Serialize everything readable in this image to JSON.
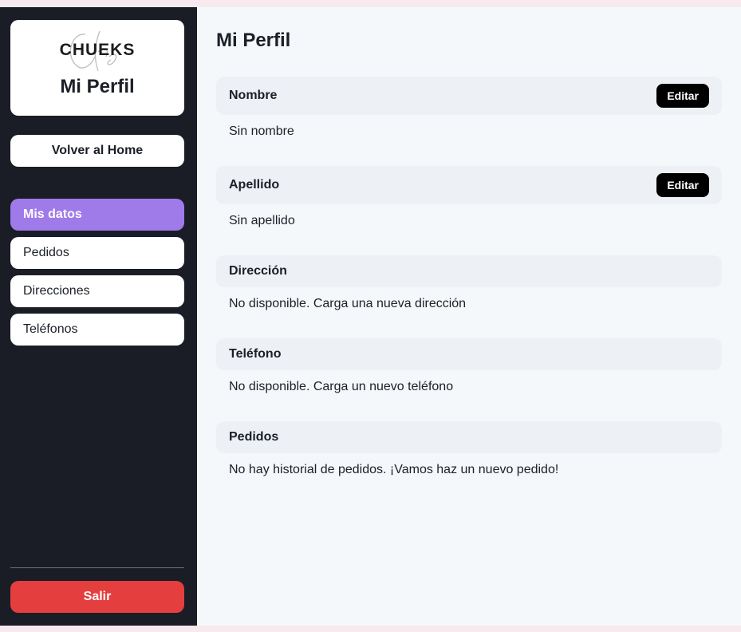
{
  "sidebar": {
    "logo_text": "CHUEKS",
    "brand_title": "Mi Perfil",
    "home_button": "Volver al Home",
    "nav": [
      {
        "label": "Mis datos",
        "active": true
      },
      {
        "label": "Pedidos",
        "active": false
      },
      {
        "label": "Direcciones",
        "active": false
      },
      {
        "label": "Teléfonos",
        "active": false
      }
    ],
    "logout_button": "Salir"
  },
  "main": {
    "title": "Mi Perfil",
    "sections": [
      {
        "label": "Nombre",
        "value": "Sin nombre",
        "edit_label": "Editar"
      },
      {
        "label": "Apellido",
        "value": "Sin apellido",
        "edit_label": "Editar"
      },
      {
        "label": "Dirección",
        "value": "No disponible. Carga una nueva dirección"
      },
      {
        "label": "Teléfono",
        "value": "No disponible. Carga un nuevo teléfono"
      },
      {
        "label": "Pedidos",
        "value": "No hay historial de pedidos. ¡Vamos haz un nuevo pedido!"
      }
    ]
  },
  "colors": {
    "sidebar_bg": "#1a1d26",
    "active_nav": "#9f7ae9",
    "logout": "#e53e3e",
    "main_bg": "#f5f8fb",
    "section_head_bg": "#edf1f5"
  }
}
